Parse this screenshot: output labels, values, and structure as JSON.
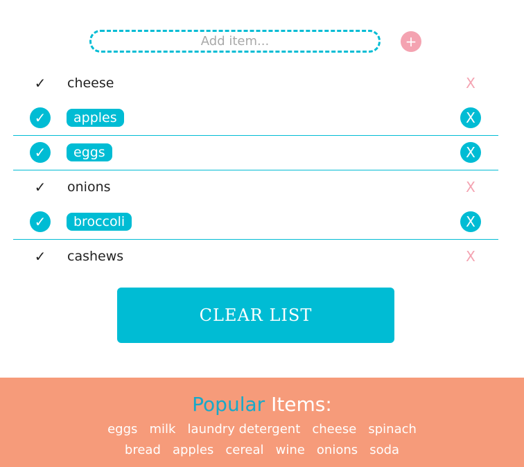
{
  "add": {
    "placeholder": "Add item...",
    "button_label": "+"
  },
  "items": [
    {
      "label": "cheese",
      "checked": false
    },
    {
      "label": "apples",
      "checked": true
    },
    {
      "label": "eggs",
      "checked": true
    },
    {
      "label": "onions",
      "checked": false
    },
    {
      "label": "broccoli",
      "checked": true
    },
    {
      "label": "cashews",
      "checked": false
    }
  ],
  "check_symbol": "✓",
  "remove_symbol": "X",
  "clear_label": "CLEAR LIST",
  "popular": {
    "title_accent": "Popular",
    "title_rest": "Items:",
    "tags": [
      "eggs",
      "milk",
      "laundry detergent",
      "cheese",
      "spinach",
      "bread",
      "apples",
      "cereal",
      "wine",
      "onions",
      "soda"
    ]
  },
  "colors": {
    "accent": "#00bcd4",
    "pink": "#f4a3b1",
    "footer": "#f69b7a"
  }
}
